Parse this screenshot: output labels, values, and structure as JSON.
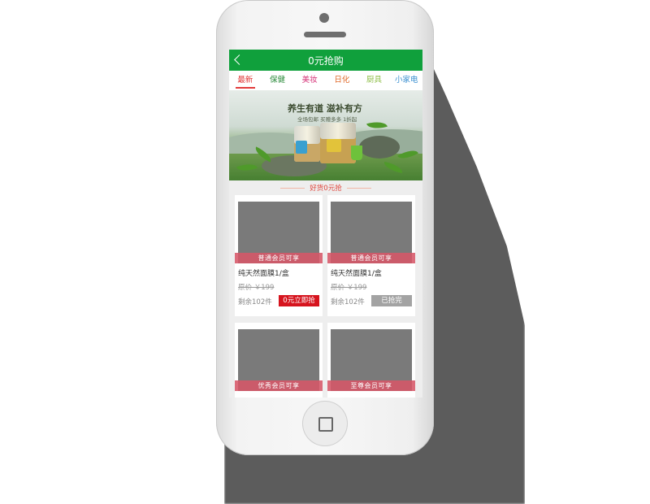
{
  "header": {
    "title": "0元抢购"
  },
  "tabs": [
    {
      "label": "最新",
      "color": "#e23b3b"
    },
    {
      "label": "保健",
      "color": "#2a8a3a"
    },
    {
      "label": "美妆",
      "color": "#d6367a"
    },
    {
      "label": "日化",
      "color": "#e06a2a"
    },
    {
      "label": "厨具",
      "color": "#8fbf4a"
    },
    {
      "label": "小家电",
      "color": "#3a8fd0"
    }
  ],
  "banner": {
    "slogan": "养生有道 滋补有方",
    "subline": "全场包邮  买赠多多  1折起"
  },
  "section": {
    "title": "好货0元抢"
  },
  "products": [
    {
      "tier": "普通会员可享",
      "name": "纯天然面膜1/盒",
      "original": "原价 ￥199",
      "remain": "剩余102件",
      "button": "0元立即抢",
      "state": "active"
    },
    {
      "tier": "普通会员可享",
      "name": "纯天然面膜1/盒",
      "original": "原价 ￥199",
      "remain": "剩余102件",
      "button": "已抢完",
      "state": "soldout"
    },
    {
      "tier": "优秀会员可享"
    },
    {
      "tier": "至尊会员可享"
    }
  ],
  "colors": {
    "header": "#10a03c",
    "cta": "#d6141e",
    "tier": "#d65668"
  }
}
